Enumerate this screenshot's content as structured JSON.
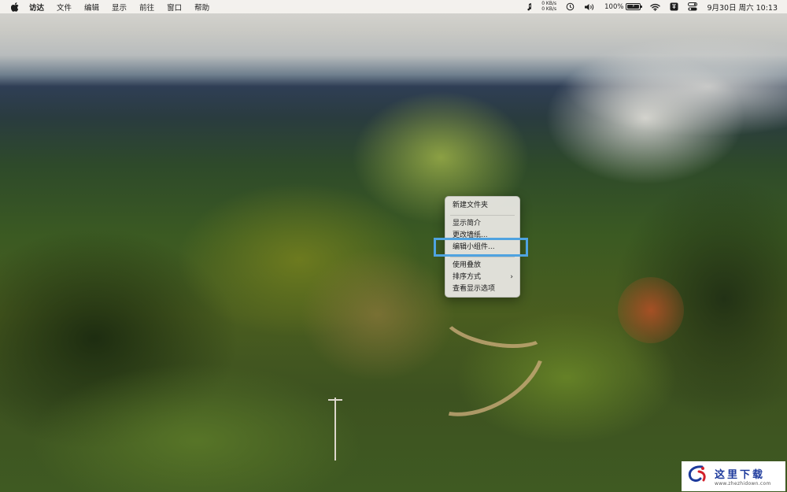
{
  "menubar": {
    "app_name": "访达",
    "items": [
      "文件",
      "编辑",
      "显示",
      "前往",
      "窗口",
      "帮助"
    ],
    "net_up": "0 KB/s",
    "net_down": "0 KB/s",
    "battery_percent": "100%",
    "battery_label": "⚡",
    "clock": "9月30日 周六 10:13"
  },
  "context_menu": {
    "items": [
      {
        "label": "新建文件夹"
      },
      {
        "label": "显示简介"
      },
      {
        "label": "更改墙纸..."
      },
      {
        "label": "编辑小组件..."
      },
      {
        "label": "使用叠放"
      },
      {
        "label": "排序方式"
      },
      {
        "label": "查看显示选项"
      }
    ],
    "highlighted_item": "编辑小组件...",
    "highlight_color": "#4fa3e0"
  },
  "watermark": {
    "title": "这里下载",
    "url": "www.zhezhidown.com"
  },
  "icons": {
    "apple": "apple-icon",
    "music": "music-note-icon",
    "time_machine": "time-machine-icon",
    "volume": "volume-icon",
    "wifi": "wifi-icon",
    "input_method": "input-method-icon",
    "control_center": "control-center-icon",
    "submenu": "chevron-right-icon"
  }
}
